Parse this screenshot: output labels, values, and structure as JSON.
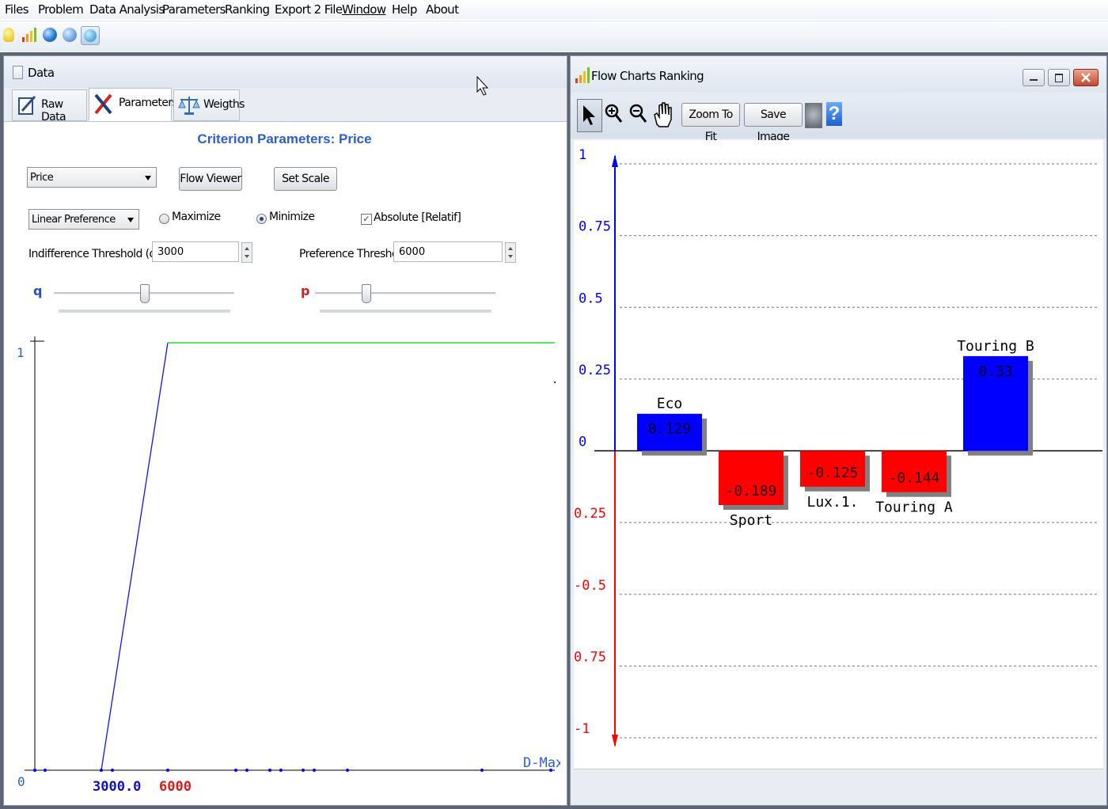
{
  "menu": [
    "Files",
    "Problem",
    "Data Analysis",
    "Parameters",
    "Ranking",
    "Export 2 File",
    "Window",
    "Help",
    "About"
  ],
  "toolbar_icons": [
    "lightbulb-icon",
    "bar-chart-icon",
    "globe-icon",
    "refresh-icon",
    "check-globe-icon"
  ],
  "data_window": {
    "title": "Data",
    "tabs": [
      "Raw Data",
      "Parameters",
      "Weigths"
    ],
    "active_tab": "Parameters",
    "heading": "Criterion Parameters: Price",
    "criterion_select": "Price",
    "flow_viewer_label": "Flow Viewer",
    "set_scale_label": "Set Scale",
    "preference_select": "Linear Preference",
    "maximize_label": "Maximize",
    "minimize_label": "Minimize",
    "minimize_selected": true,
    "absolute_label": "Absolute [Relatif]",
    "absolute_checked": true,
    "indifference_label": "Indifference Threshold (q) :",
    "indifference_value": "3000",
    "preference_label": "Preference Threshold (p) :",
    "preference_value": "6000",
    "q_label": "q",
    "p_label": "p",
    "q_slider_level": 0.5,
    "p_slider_level": 0.27
  },
  "pref_chart": {
    "y_label_top": "1",
    "x_origin_label": "0",
    "q_tick_label": "3000.0",
    "p_tick_label": "6000",
    "x_end_label": "D-Max",
    "colors": {
      "axis": "#000000",
      "ramp": "#0000ff",
      "plateau": "#00dd00",
      "q": "#0000cc",
      "p": "#dd0000"
    }
  },
  "flow_window": {
    "title": "Flow Charts Ranking",
    "zoom_to_fit_label": "Zoom To Fit",
    "save_image_label": "Save Image",
    "tool_icons": [
      "pointer-icon",
      "zoom-in-icon",
      "zoom-out-icon",
      "pan-hand-icon"
    ]
  },
  "chart_data": {
    "type": "bar",
    "categories": [
      "Eco",
      "Sport",
      "Lux.1.",
      "Touring A",
      "Touring B"
    ],
    "values": [
      0.129,
      -0.189,
      -0.125,
      -0.144,
      0.33
    ],
    "value_labels": [
      "0.129",
      "-0.189",
      "-0.125",
      "-0.144",
      "0.33"
    ],
    "ylim": [
      -1,
      1
    ],
    "y_ticks": [
      "1",
      "0.75",
      "0.5",
      "0.25",
      "0",
      "0.25",
      "-0.5",
      "0.75",
      "-1"
    ],
    "y_tick_values": [
      1,
      0.75,
      0.5,
      0.25,
      0,
      -0.25,
      -0.5,
      -0.75,
      -1
    ],
    "grid": true,
    "colors": {
      "positive": "#0000ff",
      "negative": "#ff0000",
      "shadow": "#808080"
    }
  }
}
